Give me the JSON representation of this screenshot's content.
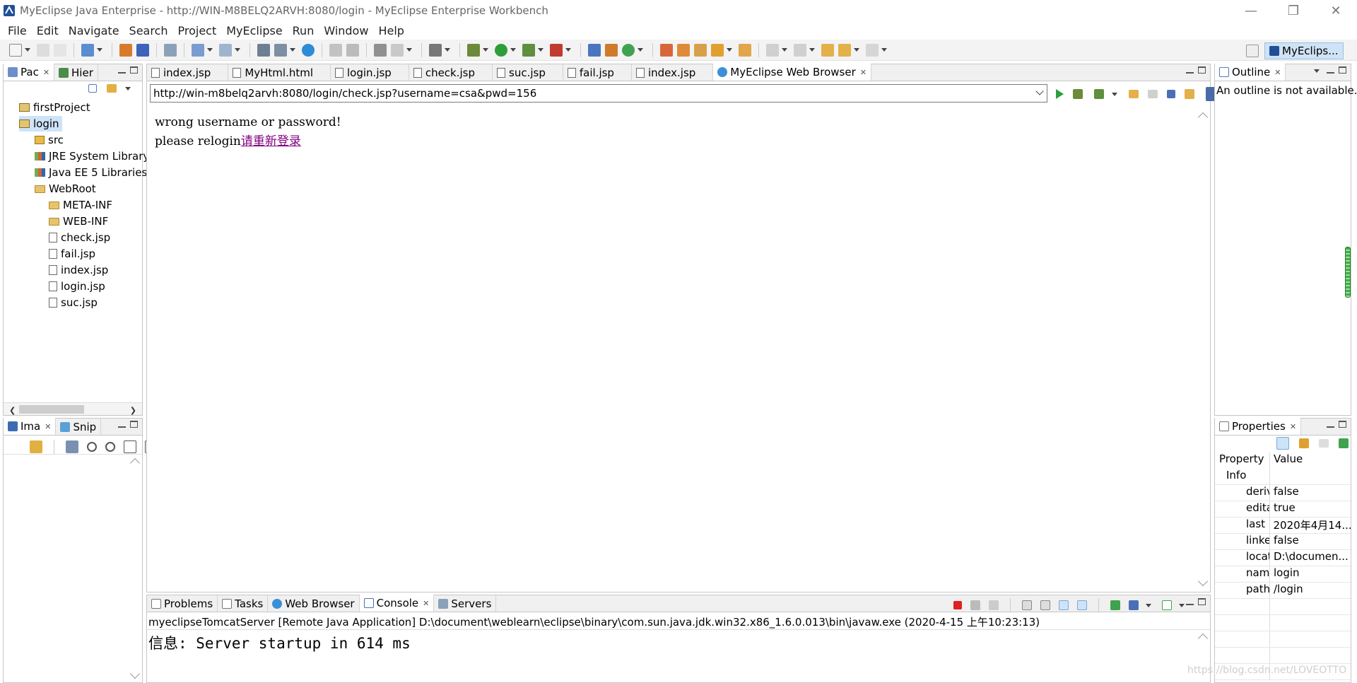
{
  "window": {
    "title": "MyEclipse Java Enterprise - http://WIN-M8BELQ2ARVH:8080/login - MyEclipse Enterprise Workbench"
  },
  "menu": [
    "File",
    "Edit",
    "Navigate",
    "Search",
    "Project",
    "MyEclipse",
    "Run",
    "Window",
    "Help"
  ],
  "perspective": {
    "label": "MyEclips..."
  },
  "explorer": {
    "tabs": [
      "Pac",
      "Hier"
    ],
    "tree": [
      {
        "label": "firstProject",
        "depth": 0,
        "icon": "project"
      },
      {
        "label": "login",
        "depth": 0,
        "icon": "project-open",
        "selected": true
      },
      {
        "label": "src",
        "depth": 1,
        "icon": "source-folder"
      },
      {
        "label": "JRE System Library",
        "depth": 1,
        "icon": "library"
      },
      {
        "label": "Java EE 5 Libraries",
        "depth": 1,
        "icon": "library"
      },
      {
        "label": "WebRoot",
        "depth": 1,
        "icon": "folder-open"
      },
      {
        "label": "META-INF",
        "depth": 2,
        "icon": "folder"
      },
      {
        "label": "WEB-INF",
        "depth": 2,
        "icon": "folder"
      },
      {
        "label": "check.jsp",
        "depth": 2,
        "icon": "jsp-file"
      },
      {
        "label": "fail.jsp",
        "depth": 2,
        "icon": "jsp-file"
      },
      {
        "label": "index.jsp",
        "depth": 2,
        "icon": "jsp-file"
      },
      {
        "label": "login.jsp",
        "depth": 2,
        "icon": "jsp-file"
      },
      {
        "label": "suc.jsp",
        "depth": 2,
        "icon": "jsp-file"
      }
    ]
  },
  "image_panel": {
    "tabs": [
      "Ima",
      "Snip"
    ]
  },
  "editor": {
    "tabs": [
      "index.jsp",
      "MyHtml.html",
      "login.jsp",
      "check.jsp",
      "suc.jsp",
      "fail.jsp",
      "index.jsp",
      "MyEclipse Web Browser"
    ],
    "active_tab": 7,
    "url": "http://win-m8belq2arvh:8080/login/check.jsp?username=csa&pwd=156",
    "content": {
      "line1": "wrong username or password!",
      "line2_prefix": "please relogin",
      "link": "请重新登录"
    }
  },
  "outline": {
    "tab": "Outline",
    "message": "An outline is not available."
  },
  "properties": {
    "tab": "Properties",
    "header_property": "Property",
    "header_value": "Value",
    "group": "Info",
    "rows": [
      {
        "key": "derived",
        "value": "false"
      },
      {
        "key": "editable",
        "value": "true"
      },
      {
        "key": "last modified",
        "value": "2020年4月14..."
      },
      {
        "key": "linked",
        "value": "false"
      },
      {
        "key": "location",
        "value": "D:\\documen..."
      },
      {
        "key": "name",
        "value": "login"
      },
      {
        "key": "path",
        "value": "/login"
      }
    ]
  },
  "console": {
    "tabs": [
      "Problems",
      "Tasks",
      "Web Browser",
      "Console",
      "Servers"
    ],
    "active_tab": 3,
    "process": "myeclipseTomcatServer [Remote Java Application] D:\\document\\weblearn\\eclipse\\binary\\com.sun.java.jdk.win32.x86_1.6.0.013\\bin\\javaw.exe (2020-4-15 上午10:23:13)",
    "output": "信息: Server startup in 614 ms"
  },
  "watermark": "https://blog.csdn.net/LOVEOTTO",
  "colors": {
    "selection": "#cde3f7",
    "link": "#800080",
    "accent": "#3a78c3"
  }
}
